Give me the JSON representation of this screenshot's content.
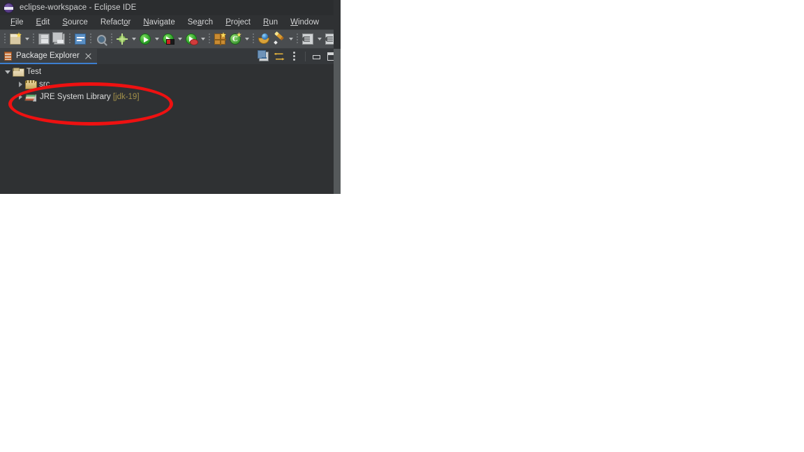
{
  "window": {
    "title": "eclipse-workspace - Eclipse IDE",
    "logo_icon": "eclipse-logo-icon",
    "background_color": "#2f3133"
  },
  "menubar": {
    "items": [
      {
        "label": "File",
        "before": "",
        "mnemonic": "F",
        "after": "ile"
      },
      {
        "label": "Edit",
        "before": "",
        "mnemonic": "E",
        "after": "dit"
      },
      {
        "label": "Source",
        "before": "",
        "mnemonic": "S",
        "after": "ource"
      },
      {
        "label": "Refactor",
        "before": "Refact",
        "mnemonic": "o",
        "after": "r"
      },
      {
        "label": "Navigate",
        "before": "",
        "mnemonic": "N",
        "after": "avigate"
      },
      {
        "label": "Search",
        "before": "Se",
        "mnemonic": "a",
        "after": "rch"
      },
      {
        "label": "Project",
        "before": "",
        "mnemonic": "P",
        "after": "roject"
      },
      {
        "label": "Run",
        "before": "",
        "mnemonic": "R",
        "after": "un"
      },
      {
        "label": "Window",
        "before": "",
        "mnemonic": "W",
        "after": "indow"
      }
    ]
  },
  "toolbar": {
    "background_color": "#494c4f",
    "buttons": [
      {
        "name": "new-wizard-button",
        "icon": "new-folder-star-icon",
        "dropdown": true
      },
      {
        "name": "save-button",
        "icon": "save-floppy-icon",
        "dropdown": false
      },
      {
        "name": "save-all-button",
        "icon": "save-all-icon",
        "dropdown": false
      },
      {
        "name": "print-button",
        "icon": "blue-document-icon",
        "dropdown": false
      },
      {
        "name": "search-button",
        "icon": "search-magnifier-icon",
        "dropdown": false
      },
      {
        "name": "external-tools-button",
        "icon": "sparkle-icon",
        "dropdown": true
      },
      {
        "name": "run-button",
        "icon": "run-play-icon",
        "dropdown": true
      },
      {
        "name": "debug-button",
        "icon": "debug-icon",
        "dropdown": true
      },
      {
        "name": "run-last-button",
        "icon": "run-stop-icon",
        "dropdown": true
      },
      {
        "name": "new-java-project-button",
        "icon": "java-project-icon",
        "dropdown": false
      },
      {
        "name": "new-class-button",
        "icon": "new-class-icon",
        "dropdown": true
      },
      {
        "name": "open-type-button",
        "icon": "open-type-icon",
        "dropdown": false
      },
      {
        "name": "annotate-button",
        "icon": "pencil-icon",
        "dropdown": true
      },
      {
        "name": "export-button",
        "icon": "export-doc-icon",
        "dropdown": true
      }
    ]
  },
  "view": {
    "tab": {
      "label": "Package Explorer",
      "icon": "package-explorer-icon",
      "close_icon": "close-icon",
      "active": true,
      "underline_color": "#3d7fd1"
    },
    "tools": [
      {
        "name": "collapse-all-button",
        "icon": "collapse-all-icon"
      },
      {
        "name": "link-with-editor-button",
        "icon": "link-editor-icon"
      },
      {
        "name": "view-menu-button",
        "icon": "vertical-dots-icon"
      },
      {
        "name": "minimize-view-button",
        "icon": "minimize-icon"
      },
      {
        "name": "maximize-view-button",
        "icon": "maximize-icon"
      }
    ]
  },
  "tree": {
    "nodes": [
      {
        "label": "Test",
        "icon": "java-project-folder-icon",
        "twisty": "open",
        "indent": 0,
        "suffix": ""
      },
      {
        "label": "src",
        "icon": "source-folder-icon",
        "twisty": "closed",
        "indent": 1,
        "suffix": ""
      },
      {
        "label": "JRE System Library ",
        "icon": "jre-library-icon",
        "twisty": "closed",
        "indent": 1,
        "suffix": "[jdk-19]"
      }
    ]
  },
  "annotation": {
    "shape": "ellipse",
    "color": "#ee1111",
    "stroke_width": 5,
    "encircles": [
      "src",
      "JRE System Library [jdk-19]"
    ]
  }
}
